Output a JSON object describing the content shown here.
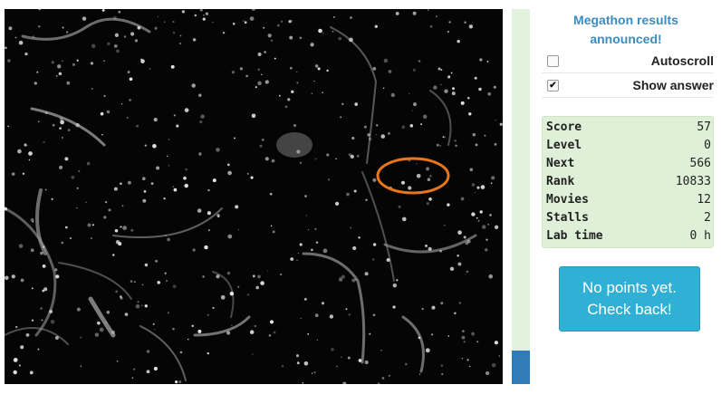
{
  "announcement": "Megathon results announced!",
  "options": {
    "autoscroll": {
      "label": "Autoscroll",
      "checked": false
    },
    "show_answer": {
      "label": "Show answer",
      "checked": true
    }
  },
  "stats": [
    {
      "key": "Score",
      "value": "57"
    },
    {
      "key": "Level",
      "value": "0"
    },
    {
      "key": "Next",
      "value": "566"
    },
    {
      "key": "Rank",
      "value": "10833"
    },
    {
      "key": "Movies",
      "value": "12"
    },
    {
      "key": "Stalls",
      "value": "2"
    },
    {
      "key": "Lab time",
      "value": "0 h"
    }
  ],
  "cta_label": "No points yet. Check back!",
  "progress_fraction": 0.09,
  "colors": {
    "announcement": "#3a8dc0",
    "progress_track": "#e2f3dd",
    "progress_fill": "#2f7cb8",
    "stats_bg": "#dff0d8",
    "cta_bg": "#31b0d5",
    "answer_marker": "#e8761e"
  }
}
